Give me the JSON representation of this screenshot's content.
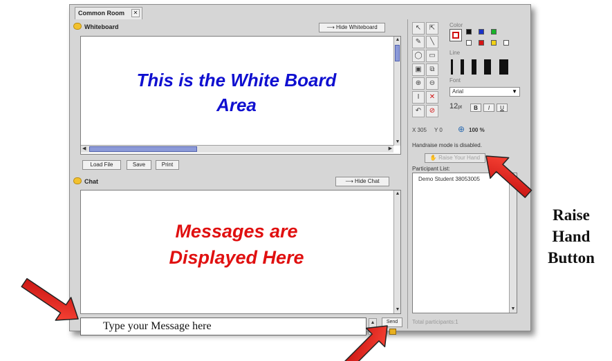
{
  "tab": {
    "title": "Common Room",
    "close_glyph": "✕"
  },
  "whiteboard": {
    "title": "Whiteboard",
    "hide_button": "⟶ Hide Whiteboard",
    "overlay_line1": "This is the White Board",
    "overlay_line2": "Area",
    "load_button": "Load File",
    "save_button": "Save",
    "print_button": "Print"
  },
  "chat": {
    "title": "Chat",
    "hide_button": "⟶ Hide Chat",
    "overlay_line1": "Messages are",
    "overlay_line2": "Displayed Here",
    "input_placeholder": "Type your Message here",
    "send_button": "Send"
  },
  "tools": {
    "color_label": "Color",
    "line_label": "Line",
    "font_label": "Font",
    "font_name": "Arial",
    "font_size": "12",
    "font_unit": "pt",
    "bold": "B",
    "italic": "I",
    "underline": "U",
    "coords_x": "X 305",
    "coords_y": "Y 0",
    "zoom": "100 %"
  },
  "sidebar": {
    "handraise_status": "Handraise mode is disabled.",
    "raise_hand_button": "Raise Your Hand",
    "participant_list_label": "Participant List:",
    "participants": [
      "Demo Student 38053005"
    ],
    "total": "Total participants:1"
  },
  "callouts": {
    "raise_line1": "Raise",
    "raise_line2": "Hand",
    "raise_line3": "Button"
  },
  "colors": {
    "arrow": "#e51818",
    "whiteboard_text": "#1010d0",
    "chat_text": "#e01010"
  }
}
